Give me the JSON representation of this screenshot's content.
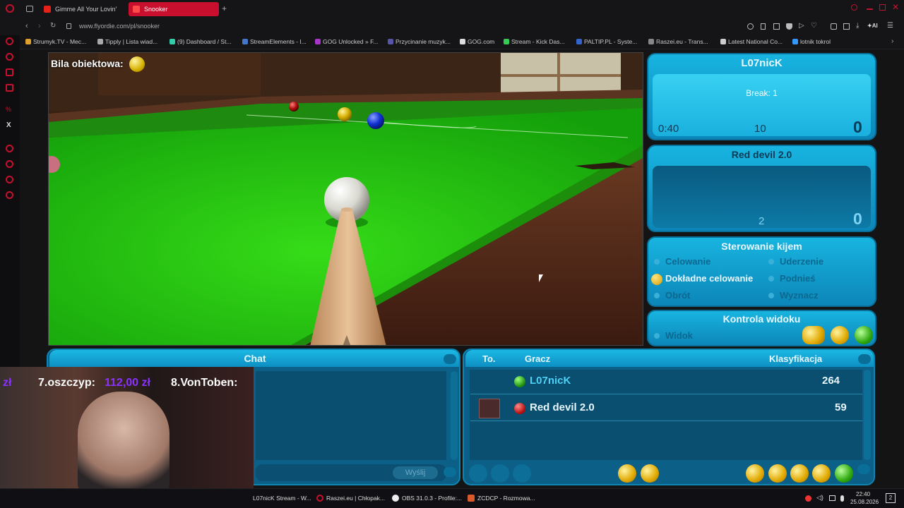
{
  "tabs": [
    {
      "label": "Gimme All Your Lovin'"
    },
    {
      "label": "Snooker"
    },
    {
      "label": "+"
    }
  ],
  "address": {
    "url": "www.flyordie.com/pl/snooker"
  },
  "bookmarks": [
    "Strumyk.TV - Mec...",
    "Tipply | Lista wiad...",
    "(9) Dashboard / St...",
    "StreamElements - I...",
    "GOG Unlocked » F...",
    "Przycinanie muzyk...",
    "GOG.com",
    "Stream - Kick Das...",
    "PALTIP.PL - Syste...",
    "Raszei.eu - Trans...",
    "Latest National Co...",
    "lotnik tokrol"
  ],
  "game": {
    "object_ball_label": "Bila obiektowa:",
    "player1": {
      "name": "L07nicK",
      "break_label": "Break: 1",
      "timer": "0:40",
      "mid": "10",
      "score": "0"
    },
    "player2": {
      "name": "Red devil 2.0",
      "mid": "2",
      "score": "0"
    },
    "cue_control": {
      "title": "Sterowanie kijem",
      "options": [
        "Celowanie",
        "Uderzenie",
        "Dokładne celowanie",
        "Podnieś",
        "Obrót",
        "Wyznacz"
      ]
    },
    "view_control": {
      "title": "Kontrola widoku",
      "option": "Widok"
    },
    "chat": {
      "title": "Chat",
      "send": "Wyślij"
    },
    "ranking": {
      "col_to": "To.",
      "col_player": "Gracz",
      "col_class": "Klasyfikacja",
      "rows": [
        {
          "name": "L07nicK",
          "score": "264"
        },
        {
          "name": "Red devil 2.0",
          "score": "59"
        }
      ]
    }
  },
  "overlay": {
    "donation_prefix": "zł",
    "donor7": "7.oszczyp:",
    "amount7": "112,00 zł",
    "donor8": "8.VonToben:"
  },
  "taskbar": {
    "items": [
      "L07nicK Stream - W...",
      "Raszei.eu | Chłopak...",
      "OBS 31.0.3 - Profile:...",
      "ZCDCP - Rozmowa..."
    ],
    "time": "22:40",
    "date": "25.08.2026",
    "notif": "2"
  }
}
